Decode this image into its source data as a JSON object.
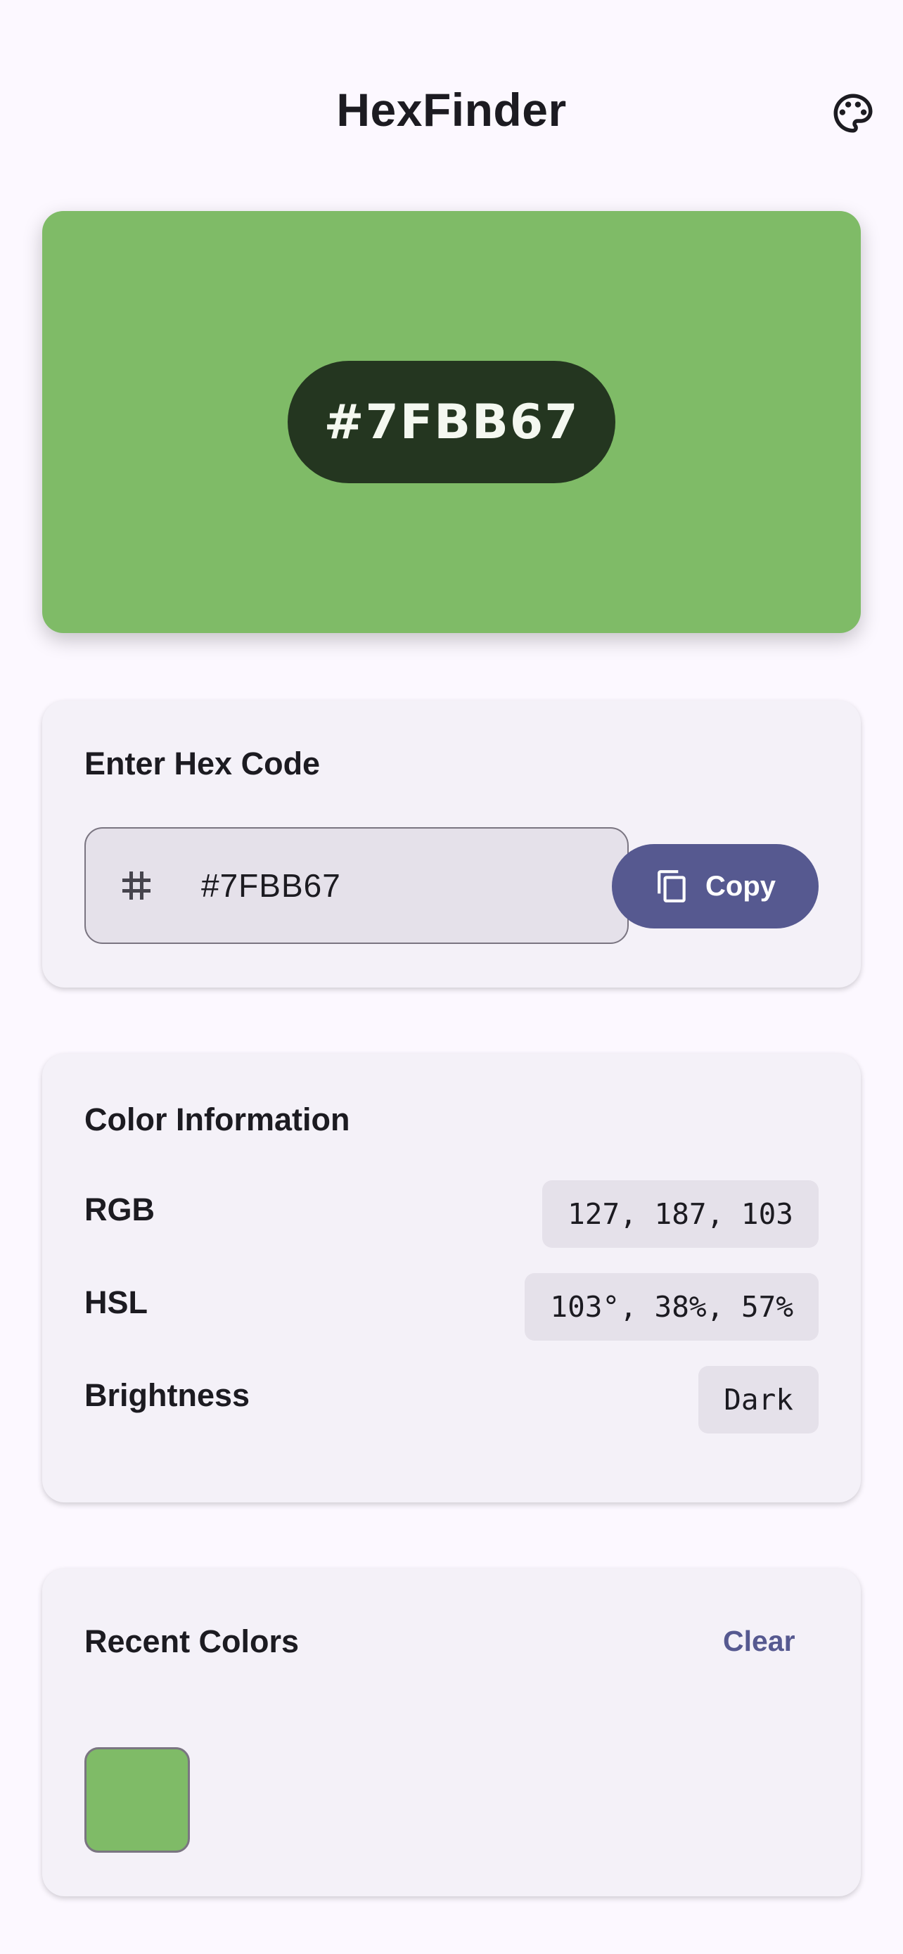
{
  "header": {
    "title": "HexFinder",
    "palette_icon": "palette-icon"
  },
  "preview": {
    "hex": "#7FBB67",
    "color": "#7FBB67",
    "pill_color": "#243620"
  },
  "input_card": {
    "title": "Enter Hex Code",
    "field_icon": "hash-icon",
    "value": "#7FBB67",
    "copy_icon": "copy-icon",
    "copy_label": "Copy"
  },
  "info_card": {
    "title": "Color Information",
    "rows": [
      {
        "label": "RGB",
        "value": "127, 187, 103"
      },
      {
        "label": "HSL",
        "value": "103°, 38%, 57%"
      },
      {
        "label": "Brightness",
        "value": "Dark"
      }
    ]
  },
  "recent_card": {
    "title": "Recent Colors",
    "clear_label": "Clear",
    "colors": [
      "#7FBB67"
    ]
  },
  "theme": {
    "background": "#fcf8ff",
    "card": "#f4f1f8",
    "primary": "#565990",
    "chip": "#e5e1ea"
  }
}
